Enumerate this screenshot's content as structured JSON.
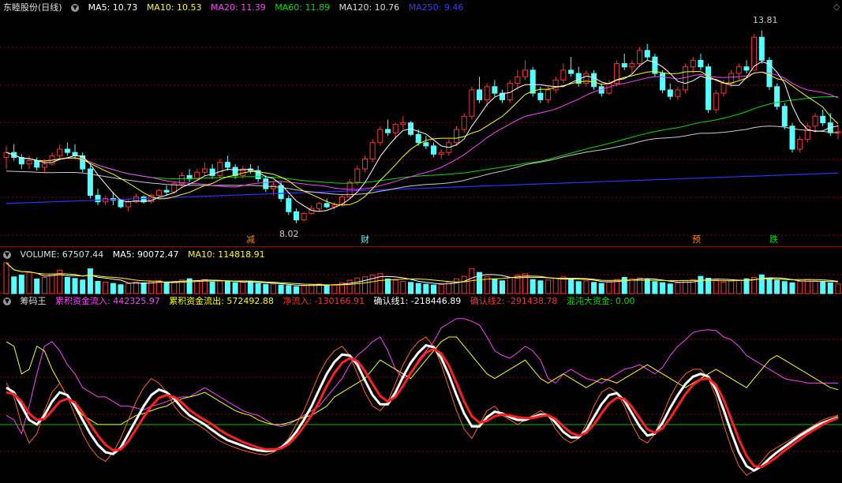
{
  "price_header": {
    "title": "东睦股份(日线)",
    "ma5": "MA5: 10.73",
    "ma10": "MA10: 10.53",
    "ma20": "MA20: 11.39",
    "ma60": "MA60: 11.89",
    "ma120": "MA120: 10.76",
    "ma250": "MA250: 9.46"
  },
  "volume_header": {
    "label": "VOLUME: 67507.44",
    "ma5": "MA5: 90072.47",
    "ma10": "MA10: 114818.91"
  },
  "indicator_header": {
    "name": "筹码王",
    "inflow": "累积资金流入: 442325.97",
    "outflow": "累积资金流出: 572492.88",
    "net": "净流入: -130166.91",
    "confirm1": "确认线1: -218446.89",
    "confirm2": "确认线2: -291438.78",
    "chaos": "混沌大资金: 0.00"
  },
  "colors": {
    "up": "#ff3232",
    "down": "#54ffff",
    "ma5": "#ffffff",
    "ma10": "#ffff00",
    "ma20": "#ff40ff",
    "ma60": "#00e000",
    "ma120": "#cccccc",
    "ma250": "#3030ff",
    "grid": "#8b0000"
  },
  "chart_data": {
    "type": "candlestick",
    "price_axis_range": [
      7.3,
      14.3
    ],
    "annotations": {
      "high": "13.81",
      "low": "8.02"
    },
    "event_tags": [
      "减",
      "财",
      "预",
      "跌"
    ],
    "bars": [
      [
        9.95,
        10.3,
        9.6,
        10.1
      ],
      [
        10.1,
        10.35,
        9.85,
        9.95
      ],
      [
        9.95,
        10.05,
        9.6,
        9.75
      ],
      [
        9.75,
        10.0,
        9.6,
        9.85
      ],
      [
        9.85,
        9.95,
        9.55,
        9.65
      ],
      [
        9.65,
        9.9,
        9.5,
        9.75
      ],
      [
        9.75,
        10.1,
        9.7,
        10.0
      ],
      [
        10.0,
        10.35,
        9.9,
        10.2
      ],
      [
        10.2,
        10.4,
        10.0,
        10.1
      ],
      [
        10.1,
        10.35,
        9.9,
        10.0
      ],
      [
        10.0,
        10.1,
        9.5,
        9.6
      ],
      [
        9.6,
        9.7,
        8.7,
        8.8
      ],
      [
        8.8,
        9.0,
        8.5,
        8.6
      ],
      [
        8.6,
        8.8,
        8.5,
        8.7
      ],
      [
        8.7,
        8.9,
        8.5,
        8.65
      ],
      [
        8.65,
        8.7,
        8.4,
        8.45
      ],
      [
        8.45,
        8.7,
        8.3,
        8.6
      ],
      [
        8.6,
        8.85,
        8.55,
        8.75
      ],
      [
        8.75,
        8.8,
        8.55,
        8.6
      ],
      [
        8.6,
        8.85,
        8.55,
        8.8
      ],
      [
        8.8,
        9.0,
        8.7,
        8.95
      ],
      [
        8.95,
        9.1,
        8.8,
        8.9
      ],
      [
        8.9,
        9.2,
        8.85,
        9.15
      ],
      [
        9.15,
        9.5,
        9.05,
        9.4
      ],
      [
        9.4,
        9.6,
        9.2,
        9.3
      ],
      [
        9.3,
        9.6,
        9.25,
        9.5
      ],
      [
        9.5,
        9.8,
        9.4,
        9.6
      ],
      [
        9.6,
        9.75,
        9.3,
        9.4
      ],
      [
        9.4,
        9.9,
        9.3,
        9.8
      ],
      [
        9.8,
        10.0,
        9.55,
        9.65
      ],
      [
        9.65,
        9.75,
        9.3,
        9.4
      ],
      [
        9.4,
        9.7,
        9.3,
        9.6
      ],
      [
        9.6,
        9.75,
        9.45,
        9.55
      ],
      [
        9.55,
        9.7,
        9.2,
        9.3
      ],
      [
        9.3,
        9.4,
        8.9,
        9.0
      ],
      [
        9.0,
        9.2,
        8.8,
        9.1
      ],
      [
        9.1,
        9.2,
        8.6,
        8.7
      ],
      [
        8.7,
        8.8,
        8.2,
        8.3
      ],
      [
        8.3,
        8.4,
        7.95,
        8.05
      ],
      [
        8.05,
        8.3,
        8.0,
        8.25
      ],
      [
        8.25,
        8.5,
        8.2,
        8.4
      ],
      [
        8.4,
        8.6,
        8.3,
        8.55
      ],
      [
        8.55,
        8.7,
        8.4,
        8.45
      ],
      [
        8.45,
        8.6,
        8.35,
        8.5
      ],
      [
        8.5,
        8.8,
        8.45,
        8.75
      ],
      [
        8.75,
        9.3,
        8.7,
        9.2
      ],
      [
        9.2,
        9.7,
        9.1,
        9.6
      ],
      [
        9.6,
        10.0,
        9.5,
        9.9
      ],
      [
        9.9,
        10.5,
        9.8,
        10.4
      ],
      [
        10.4,
        10.9,
        10.3,
        10.8
      ],
      [
        10.8,
        11.1,
        10.6,
        10.7
      ],
      [
        10.7,
        11.0,
        10.5,
        10.95
      ],
      [
        10.95,
        11.2,
        10.8,
        11.0
      ],
      [
        11.0,
        11.05,
        10.6,
        10.65
      ],
      [
        10.65,
        10.8,
        10.3,
        10.4
      ],
      [
        10.4,
        10.6,
        10.2,
        10.3
      ],
      [
        10.3,
        10.4,
        9.95,
        10.05
      ],
      [
        10.05,
        10.2,
        9.9,
        10.1
      ],
      [
        10.1,
        10.5,
        10.0,
        10.4
      ],
      [
        10.4,
        10.9,
        10.3,
        10.8
      ],
      [
        10.8,
        11.3,
        10.7,
        11.2
      ],
      [
        11.2,
        12.1,
        11.1,
        12.0
      ],
      [
        12.0,
        12.4,
        11.6,
        11.7
      ],
      [
        11.7,
        12.2,
        11.5,
        12.1
      ],
      [
        12.1,
        12.3,
        11.8,
        11.9
      ],
      [
        11.9,
        12.0,
        11.6,
        11.7
      ],
      [
        11.7,
        12.3,
        11.6,
        12.2
      ],
      [
        12.2,
        12.6,
        12.0,
        12.4
      ],
      [
        12.4,
        12.9,
        12.3,
        12.6
      ],
      [
        12.6,
        12.7,
        11.8,
        11.9
      ],
      [
        11.9,
        12.1,
        11.6,
        11.7
      ],
      [
        11.7,
        12.1,
        11.6,
        12.0
      ],
      [
        12.0,
        12.4,
        11.9,
        12.3
      ],
      [
        12.3,
        12.8,
        12.2,
        12.6
      ],
      [
        12.6,
        13.0,
        12.4,
        12.5
      ],
      [
        12.5,
        12.7,
        12.1,
        12.2
      ],
      [
        12.2,
        12.6,
        12.1,
        12.5
      ],
      [
        12.5,
        12.6,
        12.0,
        12.1
      ],
      [
        12.1,
        12.2,
        11.8,
        11.9
      ],
      [
        11.9,
        12.3,
        11.85,
        12.2
      ],
      [
        12.2,
        12.9,
        12.1,
        12.8
      ],
      [
        12.8,
        13.1,
        12.6,
        12.7
      ],
      [
        12.7,
        12.9,
        12.5,
        12.8
      ],
      [
        12.8,
        13.3,
        12.7,
        13.2
      ],
      [
        13.2,
        13.4,
        12.9,
        13.0
      ],
      [
        13.0,
        13.1,
        12.4,
        12.5
      ],
      [
        12.5,
        12.6,
        11.9,
        12.0
      ],
      [
        12.0,
        12.2,
        11.7,
        11.8
      ],
      [
        11.8,
        12.1,
        11.7,
        12.0
      ],
      [
        12.0,
        12.8,
        11.9,
        12.7
      ],
      [
        12.7,
        13.0,
        12.5,
        12.9
      ],
      [
        12.9,
        13.1,
        12.6,
        12.7
      ],
      [
        12.7,
        12.8,
        11.3,
        11.4
      ],
      [
        11.4,
        12.0,
        11.3,
        11.9
      ],
      [
        11.9,
        12.3,
        11.8,
        12.2
      ],
      [
        12.2,
        12.6,
        12.1,
        12.5
      ],
      [
        12.5,
        12.8,
        12.3,
        12.7
      ],
      [
        12.7,
        12.9,
        12.5,
        12.6
      ],
      [
        12.6,
        13.7,
        12.6,
        13.6
      ],
      [
        13.6,
        13.81,
        12.8,
        12.9
      ],
      [
        12.9,
        13.0,
        12.0,
        12.1
      ],
      [
        12.1,
        12.2,
        11.4,
        11.5
      ],
      [
        11.5,
        11.6,
        10.8,
        10.9
      ],
      [
        10.9,
        11.0,
        10.1,
        10.2
      ],
      [
        10.2,
        10.6,
        10.1,
        10.5
      ],
      [
        10.5,
        11.0,
        10.4,
        10.9
      ],
      [
        10.9,
        11.3,
        10.7,
        11.2
      ],
      [
        11.2,
        11.4,
        10.9,
        11.0
      ],
      [
        11.0,
        11.3,
        10.6,
        10.7
      ],
      [
        10.7,
        10.95,
        10.5,
        10.73
      ]
    ],
    "volume": [
      118,
      64,
      71,
      81,
      56,
      62,
      74,
      90,
      62,
      58,
      52,
      95,
      47,
      44,
      39,
      34,
      38,
      44,
      41,
      46,
      49,
      42,
      47,
      52,
      57,
      50,
      54,
      44,
      48,
      46,
      42,
      44,
      46,
      39,
      35,
      37,
      33,
      31,
      27,
      30,
      34,
      37,
      32,
      35,
      41,
      51,
      60,
      64,
      71,
      77,
      56,
      51,
      47,
      43,
      39,
      36,
      33,
      35,
      44,
      57,
      66,
      96,
      81,
      64,
      56,
      49,
      61,
      71,
      76,
      54,
      49,
      52,
      59,
      64,
      56,
      46,
      49,
      43,
      39,
      46,
      54,
      62,
      57,
      60,
      54,
      46,
      42,
      37,
      41,
      49,
      54,
      66,
      59,
      51,
      44,
      48,
      52,
      57,
      62,
      72,
      59,
      51,
      46,
      41,
      47,
      54,
      49,
      45,
      41,
      37
    ],
    "indicator": {
      "inflow": [
        0.1,
        0.05,
        -0.1,
        0.2,
        0.55,
        0.85,
        0.9,
        0.8,
        0.65,
        0.55,
        0.4,
        0.35,
        0.3,
        0.3,
        0.25,
        0.2,
        0.2,
        0.18,
        0.16,
        0.2,
        0.22,
        0.25,
        0.28,
        0.3,
        0.3,
        0.35,
        0.4,
        0.35,
        0.3,
        0.25,
        0.2,
        0.15,
        0.12,
        0.1,
        0.05,
        0.0,
        -0.02,
        0.0,
        0.05,
        0.1,
        0.15,
        0.2,
        0.3,
        0.4,
        0.5,
        0.65,
        0.75,
        0.82,
        0.9,
        0.95,
        0.8,
        0.6,
        0.5,
        0.55,
        0.7,
        0.8,
        0.9,
        1.05,
        1.1,
        1.15,
        1.15,
        1.12,
        1.08,
        0.95,
        0.8,
        0.75,
        0.72,
        0.78,
        0.85,
        0.8,
        0.7,
        0.5,
        0.45,
        0.55,
        0.6,
        0.55,
        0.5,
        0.48,
        0.45,
        0.5,
        0.55,
        0.6,
        0.62,
        0.65,
        0.6,
        0.55,
        0.62,
        0.75,
        0.85,
        0.92,
        1.0,
        1.02,
        1.03,
        1.02,
        0.95,
        0.92,
        0.85,
        0.75,
        0.7,
        0.65,
        0.6,
        0.55,
        0.5,
        0.48,
        0.47,
        0.45,
        0.45,
        0.45,
        0.45,
        0.45
      ],
      "outflow": [
        0.9,
        0.85,
        0.55,
        0.6,
        0.85,
        0.8,
        0.6,
        0.45,
        0.3,
        0.2,
        0.1,
        0.05,
        0.0,
        0.0,
        0.0,
        0.0,
        0.05,
        0.1,
        0.12,
        0.15,
        0.18,
        0.2,
        0.25,
        0.28,
        0.3,
        0.32,
        0.35,
        0.3,
        0.25,
        0.2,
        0.15,
        0.12,
        0.1,
        0.05,
        0.02,
        0.0,
        0.0,
        0.02,
        0.05,
        0.08,
        0.1,
        0.15,
        0.2,
        0.3,
        0.35,
        0.4,
        0.45,
        0.5,
        0.6,
        0.7,
        0.65,
        0.6,
        0.55,
        0.5,
        0.6,
        0.7,
        0.8,
        0.9,
        0.95,
        0.95,
        0.85,
        0.75,
        0.65,
        0.55,
        0.5,
        0.55,
        0.6,
        0.65,
        0.7,
        0.6,
        0.5,
        0.45,
        0.5,
        0.55,
        0.5,
        0.45,
        0.4,
        0.45,
        0.5,
        0.48,
        0.45,
        0.5,
        0.55,
        0.6,
        0.65,
        0.6,
        0.55,
        0.5,
        0.45,
        0.4,
        0.45,
        0.5,
        0.55,
        0.6,
        0.55,
        0.5,
        0.45,
        0.4,
        0.5,
        0.6,
        0.7,
        0.75,
        0.7,
        0.65,
        0.6,
        0.55,
        0.5,
        0.45,
        0.4,
        0.38
      ],
      "net": [
        0.45,
        0.3,
        0.0,
        -0.2,
        -0.1,
        0.15,
        0.35,
        0.45,
        0.3,
        0.1,
        -0.1,
        -0.25,
        -0.35,
        -0.4,
        -0.3,
        -0.15,
        0.05,
        0.25,
        0.4,
        0.5,
        0.45,
        0.35,
        0.2,
        0.1,
        0.05,
        0.0,
        -0.05,
        -0.12,
        -0.18,
        -0.22,
        -0.25,
        -0.28,
        -0.3,
        -0.32,
        -0.33,
        -0.3,
        -0.25,
        -0.15,
        0.0,
        0.15,
        0.35,
        0.55,
        0.7,
        0.8,
        0.85,
        0.75,
        0.55,
        0.35,
        0.2,
        0.15,
        0.25,
        0.45,
        0.65,
        0.8,
        0.9,
        0.95,
        0.85,
        0.65,
        0.4,
        0.15,
        -0.05,
        -0.15,
        0.0,
        0.15,
        0.2,
        0.1,
        0.05,
        0.0,
        0.05,
        0.1,
        0.15,
        0.1,
        -0.05,
        -0.15,
        -0.2,
        -0.15,
        0.0,
        0.2,
        0.35,
        0.4,
        0.35,
        0.2,
        0.0,
        -0.15,
        -0.2,
        -0.1,
        0.1,
        0.3,
        0.45,
        0.55,
        0.6,
        0.6,
        0.5,
        0.3,
        0.0,
        -0.25,
        -0.45,
        -0.55,
        -0.5,
        -0.4,
        -0.3,
        -0.25,
        -0.2,
        -0.15,
        -0.1,
        -0.05,
        0.0,
        0.05,
        0.08,
        0.1
      ],
      "confirm1": [
        0.4,
        0.35,
        0.2,
        0.05,
        0.0,
        0.1,
        0.25,
        0.35,
        0.32,
        0.2,
        0.05,
        -0.1,
        -0.22,
        -0.3,
        -0.32,
        -0.25,
        -0.1,
        0.05,
        0.2,
        0.32,
        0.38,
        0.35,
        0.28,
        0.18,
        0.1,
        0.05,
        0.0,
        -0.06,
        -0.12,
        -0.17,
        -0.2,
        -0.23,
        -0.26,
        -0.28,
        -0.29,
        -0.28,
        -0.25,
        -0.18,
        -0.08,
        0.05,
        0.2,
        0.38,
        0.55,
        0.68,
        0.76,
        0.75,
        0.65,
        0.48,
        0.32,
        0.22,
        0.22,
        0.35,
        0.52,
        0.67,
        0.78,
        0.86,
        0.84,
        0.72,
        0.54,
        0.32,
        0.12,
        -0.02,
        -0.02,
        0.08,
        0.14,
        0.12,
        0.08,
        0.05,
        0.05,
        0.08,
        0.11,
        0.1,
        0.02,
        -0.08,
        -0.14,
        -0.14,
        -0.06,
        0.08,
        0.22,
        0.32,
        0.34,
        0.26,
        0.12,
        -0.02,
        -0.12,
        -0.1,
        0.02,
        0.18,
        0.32,
        0.44,
        0.52,
        0.55,
        0.52,
        0.38,
        0.16,
        -0.08,
        -0.3,
        -0.45,
        -0.5,
        -0.45,
        -0.37,
        -0.3,
        -0.24,
        -0.18,
        -0.12,
        -0.07,
        -0.02,
        0.02,
        0.05,
        0.08
      ],
      "confirm2": [
        0.35,
        0.33,
        0.25,
        0.12,
        0.05,
        0.06,
        0.15,
        0.25,
        0.28,
        0.24,
        0.13,
        0.0,
        -0.12,
        -0.22,
        -0.28,
        -0.27,
        -0.18,
        -0.05,
        0.08,
        0.2,
        0.29,
        0.32,
        0.3,
        0.24,
        0.16,
        0.1,
        0.05,
        0.0,
        -0.06,
        -0.11,
        -0.15,
        -0.19,
        -0.22,
        -0.25,
        -0.27,
        -0.27,
        -0.26,
        -0.21,
        -0.13,
        -0.02,
        0.1,
        0.25,
        0.42,
        0.56,
        0.67,
        0.72,
        0.69,
        0.58,
        0.44,
        0.31,
        0.25,
        0.3,
        0.42,
        0.56,
        0.68,
        0.78,
        0.82,
        0.77,
        0.64,
        0.45,
        0.25,
        0.09,
        0.02,
        0.04,
        0.09,
        0.11,
        0.1,
        0.08,
        0.07,
        0.07,
        0.09,
        0.1,
        0.06,
        -0.02,
        -0.09,
        -0.12,
        -0.09,
        0.0,
        0.12,
        0.23,
        0.29,
        0.28,
        0.19,
        0.07,
        -0.05,
        -0.09,
        -0.04,
        0.07,
        0.2,
        0.33,
        0.43,
        0.49,
        0.5,
        0.43,
        0.27,
        0.06,
        -0.16,
        -0.34,
        -0.45,
        -0.46,
        -0.41,
        -0.35,
        -0.28,
        -0.22,
        -0.16,
        -0.1,
        -0.05,
        0.0,
        0.04,
        0.07
      ],
      "range": [
        -0.6,
        1.25
      ],
      "zero": 0.0
    }
  }
}
